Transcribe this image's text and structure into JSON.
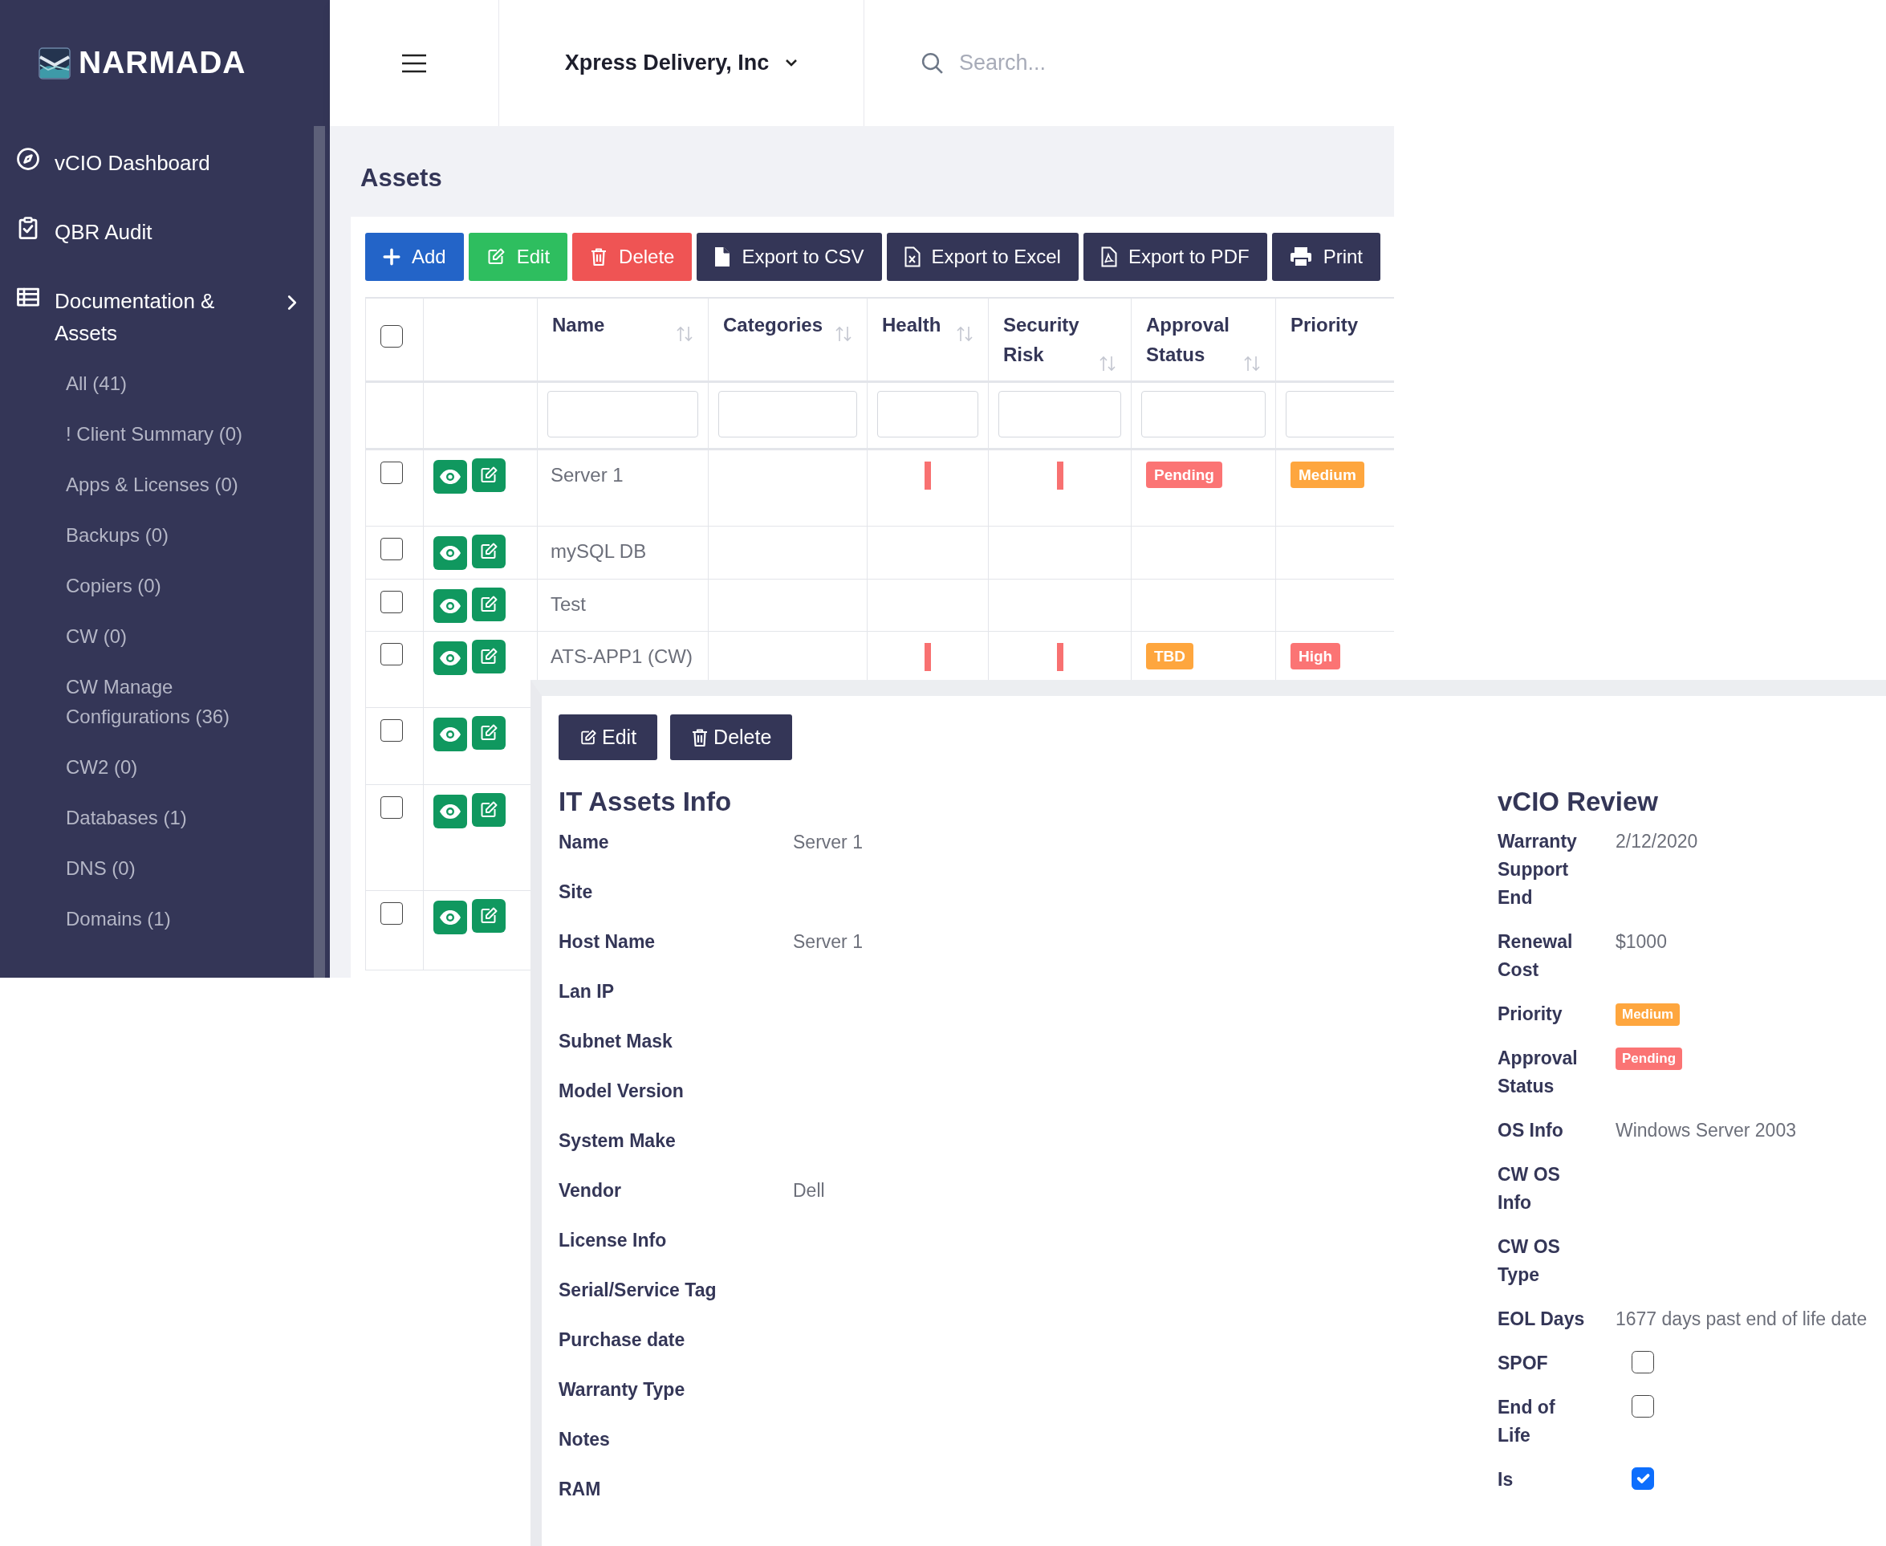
{
  "sidebar": {
    "logo": "NARMADA",
    "items": [
      {
        "label": "vCIO Dashboard"
      },
      {
        "label": "QBR Audit"
      },
      {
        "label": "Documentation & Assets",
        "children": [
          {
            "label": "All (41)"
          },
          {
            "label": "! Client Summary (0)"
          },
          {
            "label": "Apps & Licenses (0)"
          },
          {
            "label": "Backups (0)"
          },
          {
            "label": "Copiers (0)"
          },
          {
            "label": "CW (0)"
          },
          {
            "label": "CW Manage Configurations (36)"
          },
          {
            "label": "CW2 (0)"
          },
          {
            "label": "Databases (1)"
          },
          {
            "label": "DNS (0)"
          },
          {
            "label": "Domains (1)"
          }
        ]
      }
    ]
  },
  "topbar": {
    "company": "Xpress Delivery, Inc",
    "search": {
      "placeholder": "Search..."
    }
  },
  "page_title": "Assets",
  "toolbar": [
    {
      "label": "Add",
      "kind": "add"
    },
    {
      "label": "Edit",
      "kind": "edit"
    },
    {
      "label": "Delete",
      "kind": "delete"
    },
    {
      "label": "Export to CSV",
      "kind": "csv"
    },
    {
      "label": "Export to Excel",
      "kind": "excel"
    },
    {
      "label": "Export to PDF",
      "kind": "pdf"
    },
    {
      "label": "Print",
      "kind": "print"
    }
  ],
  "table": {
    "select_all": {
      "checked": false
    },
    "columns": [
      {
        "label": "Name",
        "sortable": true
      },
      {
        "label": "Categories",
        "sortable": true
      },
      {
        "label": "Health",
        "sortable": true
      },
      {
        "label": "Security Risk",
        "sortable": true
      },
      {
        "label": "Approval Status",
        "sortable": true
      },
      {
        "label": "Priority"
      }
    ],
    "rows": [
      {
        "checked": false,
        "name": "Server 1",
        "health_flag": true,
        "risk_flag": true,
        "approval": {
          "text": "Pending",
          "color": "#fb7474"
        },
        "priority": {
          "text": "Medium",
          "color": "#fea63e"
        }
      },
      {
        "checked": false,
        "name": "mySQL DB",
        "health_flag": false,
        "risk_flag": false
      },
      {
        "checked": false,
        "name": "Test",
        "health_flag": false,
        "risk_flag": false
      },
      {
        "checked": false,
        "name": "ATS-APP1 (CW)",
        "health_flag": true,
        "risk_flag": true,
        "approval": {
          "text": "TBD",
          "color": "#fea63e"
        },
        "priority": {
          "text": "High",
          "color": "#fb7474"
        }
      },
      {
        "checked": false
      },
      {
        "checked": false
      },
      {
        "checked": false
      }
    ]
  },
  "detail": {
    "buttons": [
      {
        "label": "Edit",
        "kind": "edit"
      },
      {
        "label": "Delete",
        "kind": "delete"
      }
    ],
    "sections": [
      {
        "title": "IT Assets Info",
        "fields": [
          {
            "kind": "text",
            "label": "Name",
            "value": "Server 1"
          },
          {
            "kind": "text",
            "label": "Site"
          },
          {
            "kind": "text",
            "label": "Host Name",
            "value": "Server 1"
          },
          {
            "kind": "text",
            "label": "Lan IP"
          },
          {
            "kind": "text",
            "label": "Subnet Mask"
          },
          {
            "kind": "text",
            "label": "Model Version"
          },
          {
            "kind": "text",
            "label": "System Make"
          },
          {
            "kind": "text",
            "label": "Vendor",
            "value": "Dell"
          },
          {
            "kind": "text",
            "label": "License Info"
          },
          {
            "kind": "text",
            "label": "Serial/Service Tag"
          },
          {
            "kind": "text",
            "label": "Purchase date"
          },
          {
            "kind": "text",
            "label": "Warranty Type"
          },
          {
            "kind": "text",
            "label": "Notes"
          },
          {
            "kind": "text",
            "label": "RAM"
          }
        ]
      },
      {
        "title": "vCIO Review",
        "fields": [
          {
            "kind": "text",
            "label": "Warranty Support End",
            "value": "2/12/2020"
          },
          {
            "kind": "text",
            "label": "Renewal Cost",
            "value": "$1000"
          },
          {
            "kind": "badge",
            "label": "Priority",
            "value": "Medium",
            "color": "#fea63e"
          },
          {
            "kind": "badge",
            "label": "Approval Status",
            "value": "Pending",
            "color": "#fb7474"
          },
          {
            "kind": "text",
            "label": "OS Info",
            "value": "Windows Server 2003"
          },
          {
            "kind": "text",
            "label": "CW OS Info"
          },
          {
            "kind": "text",
            "label": "CW OS Type"
          },
          {
            "kind": "text",
            "label": "EOL Days",
            "value": "1677 days past end of life date"
          },
          {
            "kind": "checkbox",
            "label": "SPOF",
            "checked": false
          },
          {
            "kind": "checkbox",
            "label": "End of Life",
            "checked": false
          },
          {
            "kind": "checkbox",
            "label": "Is",
            "checked": true
          }
        ]
      }
    ]
  }
}
